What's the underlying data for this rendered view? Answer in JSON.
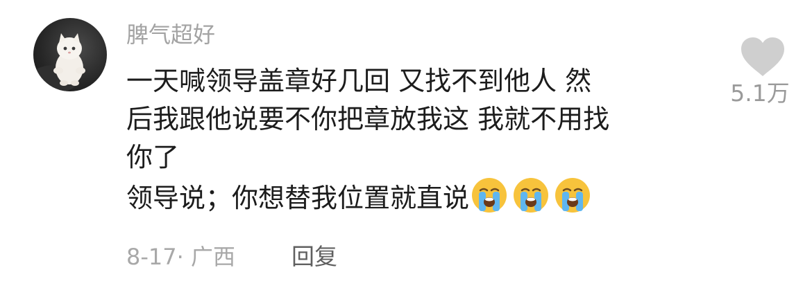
{
  "comment": {
    "username": "脾气超好",
    "lines": [
      "一天喊领导盖章好几回 又找不到他人 然",
      "后我跟他说要不你把章放我这 我就不用找",
      "你了",
      "领导说；你想替我位置就直说"
    ],
    "emoji": [
      "loudly-crying-face",
      "loudly-crying-face",
      "loudly-crying-face"
    ],
    "date": "8-17",
    "separator": "·",
    "location": "广西",
    "reply_label": "回复",
    "like_count": "5.1万"
  },
  "colors": {
    "username": "#a3a3a3",
    "text": "#1c1c1c",
    "meta": "#a8a8a8",
    "reply": "#606060",
    "like_icon": "#cfcfcf",
    "like_count": "#9a9a9a"
  }
}
